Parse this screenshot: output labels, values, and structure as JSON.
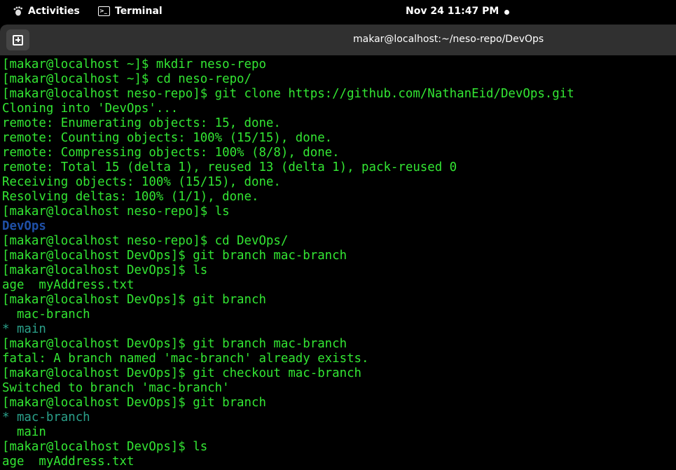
{
  "topbar": {
    "activities_label": "Activities",
    "app_label": "Terminal",
    "clock": "Nov 24  11:47 PM"
  },
  "window": {
    "title": "makar@localhost:~/neso-repo/DevOps"
  },
  "terminal": {
    "lines": [
      {
        "text": "[makar@localhost ~]$ mkdir neso-repo",
        "style": "g"
      },
      {
        "text": "[makar@localhost ~]$ cd neso-repo/",
        "style": "g"
      },
      {
        "text": "[makar@localhost neso-repo]$ git clone https://github.com/NathanEid/DevOps.git",
        "style": "g"
      },
      {
        "text": "Cloning into 'DevOps'...",
        "style": "g"
      },
      {
        "text": "remote: Enumerating objects: 15, done.",
        "style": "g"
      },
      {
        "text": "remote: Counting objects: 100% (15/15), done.",
        "style": "g"
      },
      {
        "text": "remote: Compressing objects: 100% (8/8), done.",
        "style": "g"
      },
      {
        "text": "remote: Total 15 (delta 1), reused 13 (delta 1), pack-reused 0",
        "style": "g"
      },
      {
        "text": "Receiving objects: 100% (15/15), done.",
        "style": "g"
      },
      {
        "text": "Resolving deltas: 100% (1/1), done.",
        "style": "g"
      },
      {
        "text": "[makar@localhost neso-repo]$ ls",
        "style": "g"
      },
      {
        "text": "DevOps",
        "style": "b"
      },
      {
        "text": "[makar@localhost neso-repo]$ cd DevOps/",
        "style": "g"
      },
      {
        "text": "[makar@localhost DevOps]$ git branch mac-branch",
        "style": "g"
      },
      {
        "text": "[makar@localhost DevOps]$ ls",
        "style": "g"
      },
      {
        "text": "age  myAddress.txt",
        "style": "g"
      },
      {
        "text": "[makar@localhost DevOps]$ git branch",
        "style": "g"
      },
      {
        "text": "  mac-branch",
        "style": "g"
      },
      {
        "text": "* main",
        "style": "t"
      },
      {
        "text": "[makar@localhost DevOps]$ git branch mac-branch",
        "style": "g"
      },
      {
        "text": "fatal: A branch named 'mac-branch' already exists.",
        "style": "g"
      },
      {
        "text": "[makar@localhost DevOps]$ git checkout mac-branch",
        "style": "g"
      },
      {
        "text": "Switched to branch 'mac-branch'",
        "style": "g"
      },
      {
        "text": "[makar@localhost DevOps]$ git branch",
        "style": "g"
      },
      {
        "text": "* mac-branch",
        "style": "t"
      },
      {
        "text": "  main",
        "style": "g"
      },
      {
        "text": "[makar@localhost DevOps]$ ls",
        "style": "g"
      },
      {
        "text": "age  myAddress.txt",
        "style": "g"
      }
    ]
  },
  "colors": {
    "terminal_green": "#33e633",
    "directory_blue": "#1f4fa6",
    "current_branch_teal": "#2aa08a",
    "headerbar": "#303030"
  },
  "icons": {
    "activities": "gnome-foot-icon",
    "terminal_app": "terminal-icon",
    "new_tab": "new-tab-icon",
    "notification": "notification-dot-icon"
  }
}
